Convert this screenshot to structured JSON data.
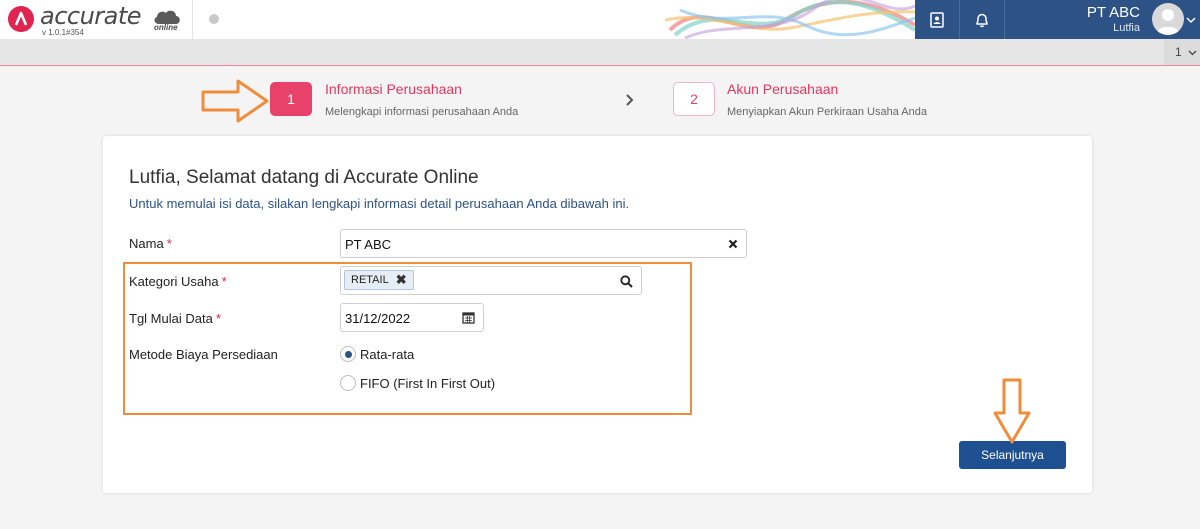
{
  "app": {
    "logo_text": "accurate",
    "logo_sub": "online",
    "version": "v 1.0.1#354",
    "company_name": "PT ABC",
    "user_name": "Lutfia",
    "page_number": "1"
  },
  "steps": [
    {
      "number": "1",
      "title": "Informasi Perusahaan",
      "subtitle": "Melengkapi informasi perusahaan Anda"
    },
    {
      "number": "2",
      "title": "Akun Perusahaan",
      "subtitle": "Menyiapkan Akun Perkiraan Usaha Anda"
    }
  ],
  "form": {
    "title": "Lutfia, Selamat datang di Accurate Online",
    "subtitle": "Untuk memulai isi data, silakan lengkapi informasi detail perusahaan Anda dibawah ini.",
    "nama_label": "Nama",
    "nama_value": "PT ABC",
    "kategori_label": "Kategori Usaha",
    "kategori_tag": "RETAIL",
    "tgl_label": "Tgl Mulai Data",
    "tgl_value": "31/12/2022",
    "metode_label": "Metode Biaya Persediaan",
    "metode_options": [
      {
        "label": "Rata-rata",
        "selected": true
      },
      {
        "label": "FIFO (First In First Out)",
        "selected": false
      }
    ],
    "required_mark": "*",
    "next_button": "Selanjutnya"
  },
  "colors": {
    "brand_red": "#e0234f",
    "navy": "#2d5286",
    "button_blue": "#1e4f91",
    "annotation_orange": "#f08c3a"
  },
  "icons": [
    "accurate-logo-icon",
    "cloud-icon",
    "address-book-icon",
    "bell-icon",
    "avatar-icon",
    "chevron-down-icon",
    "chevron-right-icon",
    "clear-icon",
    "search-icon",
    "calendar-icon"
  ]
}
